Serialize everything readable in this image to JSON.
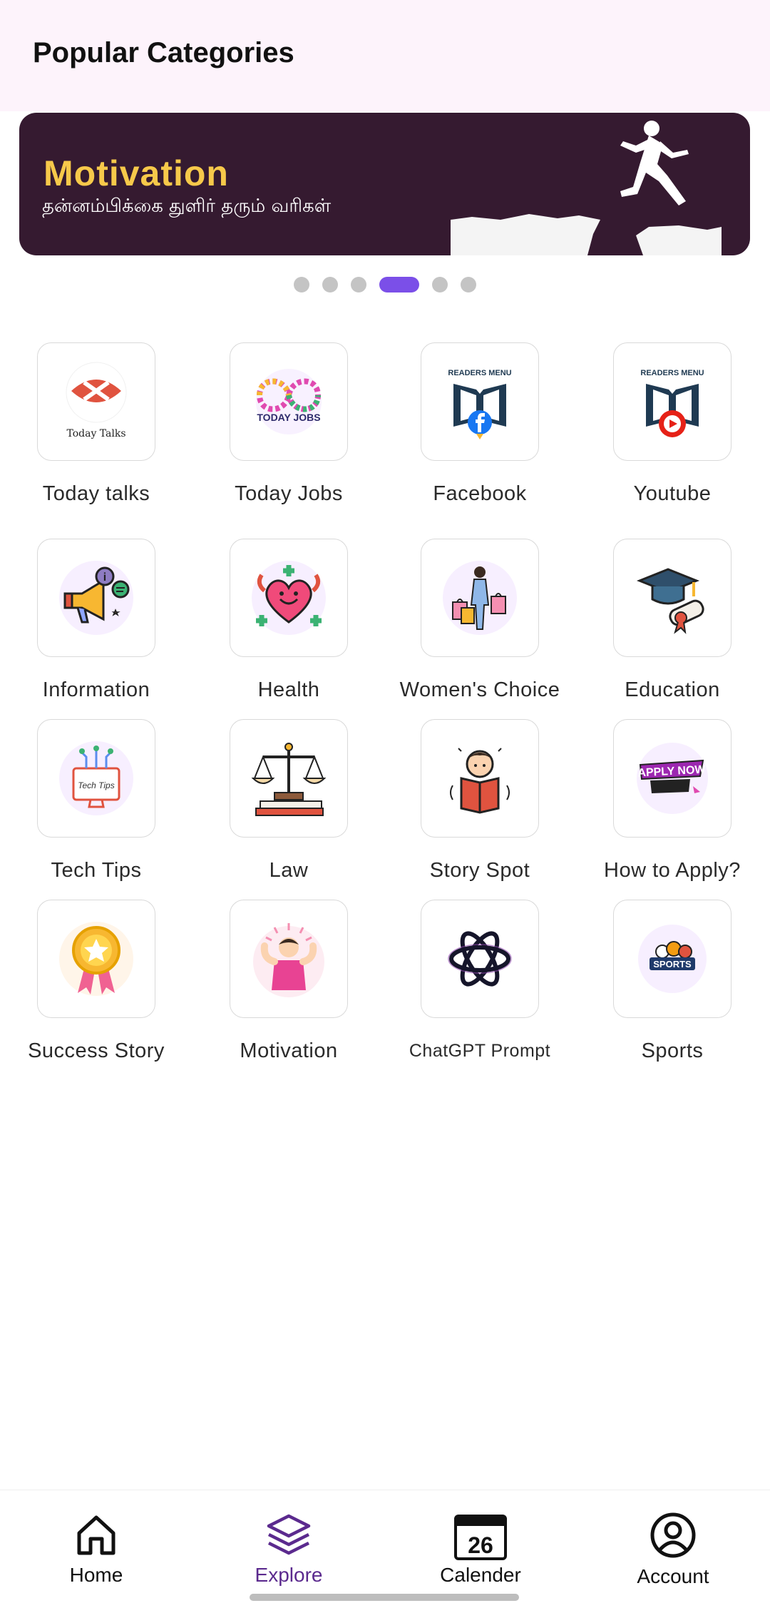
{
  "header": {
    "title": "Popular Categories"
  },
  "banner": {
    "title": "Motivation",
    "subtitle": "தன்னம்பிக்கை துளிர் தரும் வரிகள்"
  },
  "carousel": {
    "count": 6,
    "active_index": 3
  },
  "categories": [
    {
      "label": "Today talks",
      "icon": "today-talks-logo",
      "icon_text": "Today Talks"
    },
    {
      "label": "Today Jobs",
      "icon": "today-jobs-logo",
      "icon_text": "TODAY JOBS"
    },
    {
      "label": "Facebook",
      "icon": "readers-menu-facebook-logo",
      "icon_text": "READERS MENU"
    },
    {
      "label": "Youtube",
      "icon": "readers-menu-youtube-logo",
      "icon_text": "READERS MENU"
    },
    {
      "label": "Information",
      "icon": "megaphone-info-icon"
    },
    {
      "label": "Health",
      "icon": "heart-health-icon"
    },
    {
      "label": "Women's Choice",
      "icon": "shopping-woman-icon"
    },
    {
      "label": "Education",
      "icon": "graduation-cap-icon"
    },
    {
      "label": "Tech Tips",
      "icon": "tech-tips-monitor-icon",
      "icon_text": "Tech Tips"
    },
    {
      "label": "Law",
      "icon": "scales-of-justice-icon"
    },
    {
      "label": "Story Spot",
      "icon": "reading-book-icon"
    },
    {
      "label": "How to Apply?",
      "icon": "apply-now-icon",
      "icon_text": "APPLY NOW"
    },
    {
      "label": "Success Story",
      "icon": "award-ribbon-icon"
    },
    {
      "label": "Motivation",
      "icon": "motivation-person-icon"
    },
    {
      "label": "ChatGPT Prompt",
      "icon": "chatgpt-logo"
    },
    {
      "label": "Sports",
      "icon": "sports-balls-icon",
      "icon_text": "SPORTS"
    }
  ],
  "bottom_nav": {
    "items": [
      {
        "label": "Home",
        "icon": "home-icon"
      },
      {
        "label": "Explore",
        "icon": "layers-icon",
        "active": true
      },
      {
        "label": "Calender",
        "icon": "calendar-icon",
        "icon_text": "26"
      },
      {
        "label": "Account",
        "icon": "account-icon"
      }
    ]
  },
  "colors": {
    "accent": "#7b4fe8",
    "active_nav": "#5b2a8e",
    "banner_bg": "#351a30",
    "banner_title": "#f7c94a",
    "header_bg": "#fdf3fb"
  }
}
